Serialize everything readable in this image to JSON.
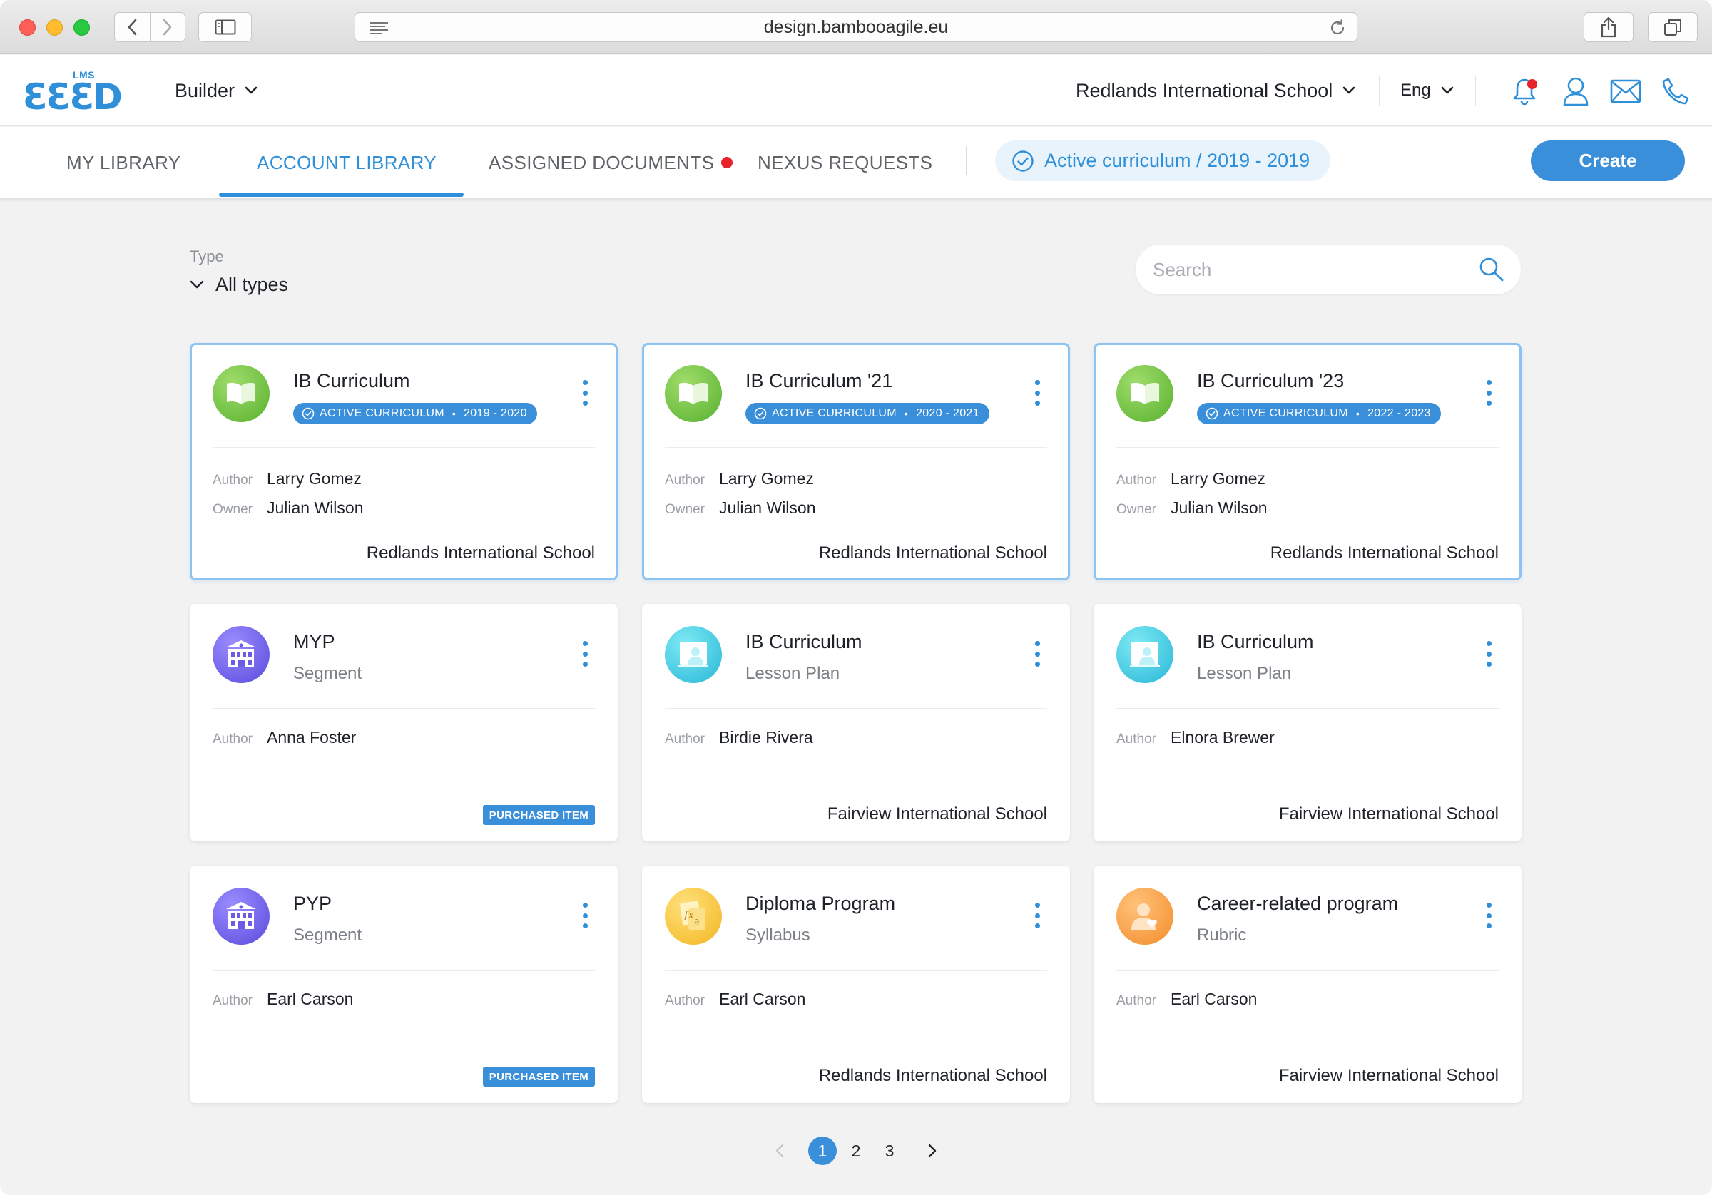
{
  "browser": {
    "url": "design.bambooagile.eu"
  },
  "header": {
    "logo_badge": "LMS",
    "logo_word": "ƐƐƐD",
    "builder_label": "Builder",
    "school": "Redlands International School",
    "language": "Eng",
    "icons": [
      "bell-icon",
      "user-icon",
      "mail-icon",
      "phone-icon"
    ]
  },
  "tabs": {
    "items": [
      {
        "label": "MY LIBRARY"
      },
      {
        "label": "ACCOUNT LIBRARY"
      },
      {
        "label": "ASSIGNED DOCUMENTS"
      },
      {
        "label": "NEXUS REQUESTS"
      }
    ],
    "active_index": 1,
    "active_curriculum": "Active curriculum / 2019 - 2019",
    "create_label": "Create"
  },
  "filters": {
    "type_label": "Type",
    "type_value": "All types",
    "search_placeholder": "Search"
  },
  "labels": {
    "author": "Author",
    "owner": "Owner",
    "active_curriculum_badge": "ACTIVE CURRICULUM",
    "purchased_item": "PURCHASED ITEM"
  },
  "cards": [
    {
      "title": "IB Curriculum",
      "years": "2019 - 2020",
      "author": "Larry Gomez",
      "owner": "Julian Wilson",
      "school": "Redlands International School",
      "icon": "book-icon"
    },
    {
      "title": "IB Curriculum '21",
      "years": "2020 - 2021",
      "author": "Larry Gomez",
      "owner": "Julian Wilson",
      "school": "Redlands International School",
      "icon": "book-icon"
    },
    {
      "title": "IB Curriculum '23",
      "years": "2022 - 2023",
      "author": "Larry Gomez",
      "owner": "Julian Wilson",
      "school": "Redlands International School",
      "icon": "book-icon"
    },
    {
      "title": "MYP",
      "subtitle": "Segment",
      "author": "Anna Foster",
      "icon": "school-building-icon"
    },
    {
      "title": "IB Curriculum",
      "subtitle": "Lesson Plan",
      "author": "Birdie Rivera",
      "school": "Fairview International School",
      "icon": "lesson-board-icon"
    },
    {
      "title": "IB Curriculum",
      "subtitle": "Lesson Plan",
      "author": "Elnora Brewer",
      "school": "Fairview International School",
      "icon": "lesson-board-icon"
    },
    {
      "title": "PYP",
      "subtitle": "Segment",
      "author": "Earl Carson",
      "icon": "school-building-icon"
    },
    {
      "title": "Diploma Program",
      "subtitle": "Syllabus",
      "author": "Earl Carson",
      "school": "Redlands International School",
      "icon": "formula-syllabus-icon"
    },
    {
      "title": "Career-related program",
      "subtitle": "Rubric",
      "author": "Earl Carson",
      "school": "Fairview International School",
      "icon": "person-heart-icon"
    }
  ],
  "pagination": {
    "pages": [
      "1",
      "2",
      "3"
    ],
    "current": "1"
  },
  "colors": {
    "accent": "#3a8fda",
    "notification_dot": "#e8222a"
  }
}
